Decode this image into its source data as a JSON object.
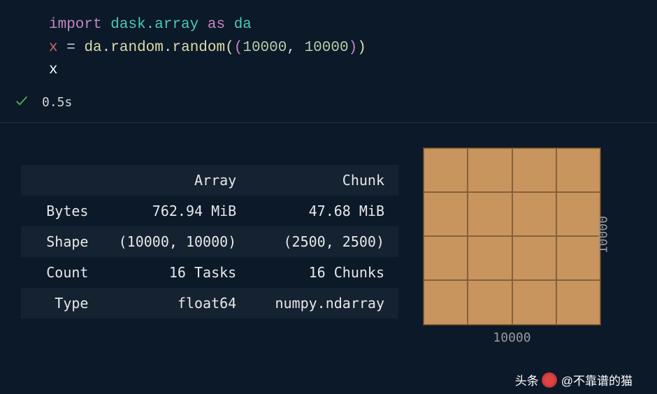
{
  "code": {
    "line1": {
      "import": "import",
      "module": "dask.array",
      "as": "as",
      "alias": "da"
    },
    "line2": {
      "var": "x",
      "eq": "=",
      "obj": "da",
      "m1": "random",
      "m2": "random",
      "n1": "10000",
      "n2": "10000"
    },
    "line3": {
      "var": "x"
    }
  },
  "status": {
    "time": "0.5s"
  },
  "table": {
    "headers": {
      "empty": "",
      "array": "Array",
      "chunk": "Chunk"
    },
    "rows": {
      "bytes": {
        "label": "Bytes",
        "array": "762.94 MiB",
        "chunk": "47.68 MiB"
      },
      "shape": {
        "label": "Shape",
        "array": "(10000, 10000)",
        "chunk": "(2500, 2500)"
      },
      "count": {
        "label": "Count",
        "array": "16 Tasks",
        "chunk": "16 Chunks"
      },
      "type": {
        "label": "Type",
        "array": "float64",
        "chunk": "numpy.ndarray"
      }
    }
  },
  "viz": {
    "x_label": "10000",
    "y_label": "10000"
  },
  "watermark": {
    "prefix": "头条",
    "text": "@不靠谱的猫"
  }
}
